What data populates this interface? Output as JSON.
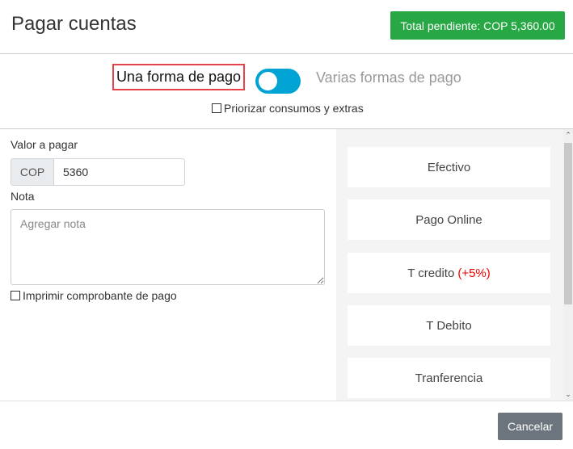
{
  "header": {
    "title": "Pagar cuentas",
    "total": "Total pendiente: COP 5,360.00"
  },
  "mode": {
    "single": "Una forma de pago",
    "multiple": "Varias formas de pago",
    "toggle_on": false,
    "prioritize": "Priorizar consumos y extras"
  },
  "form": {
    "amount_label": "Valor a pagar",
    "currency": "COP",
    "amount": "5360",
    "note_label": "Nota",
    "note_placeholder": "Agregar nota",
    "print_label": "Imprimir comprobante de pago"
  },
  "methods": [
    {
      "label": "Efectivo"
    },
    {
      "label": "Pago Online"
    },
    {
      "label": "T credito",
      "surcharge": "(+5%)"
    },
    {
      "label": "T Debito"
    },
    {
      "label": "Tranferencia"
    }
  ],
  "footer": {
    "cancel": "Cancelar"
  },
  "colors": {
    "success": "#28a745",
    "toggle": "#00a3d4",
    "highlight": "#e8434b"
  }
}
